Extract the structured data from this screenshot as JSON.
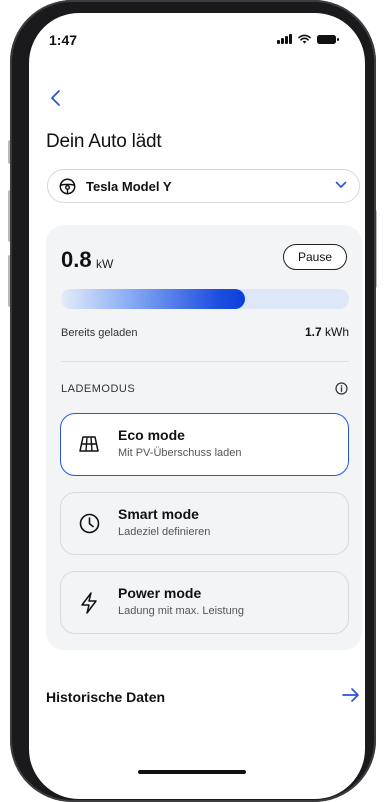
{
  "status": {
    "time": "1:47"
  },
  "header": {
    "title": "Dein Auto lädt"
  },
  "vehicle": {
    "name": "Tesla Model Y"
  },
  "charging": {
    "power_value": "0.8",
    "power_unit": "kW",
    "pause_label": "Pause",
    "progress_fraction": 0.64,
    "loaded_label": "Bereits geladen",
    "loaded_value": "1.7",
    "loaded_unit": "kWh"
  },
  "modes": {
    "section_label": "LADEMODUS",
    "items": [
      {
        "title": "Eco mode",
        "subtitle": "Mit PV-Überschuss laden",
        "icon": "solar-panel-icon",
        "active": true
      },
      {
        "title": "Smart mode",
        "subtitle": "Ladeziel definieren",
        "icon": "clock-icon",
        "active": false
      },
      {
        "title": "Power mode",
        "subtitle": "Ladung mit max. Leistung",
        "icon": "lightning-icon",
        "active": false
      }
    ]
  },
  "history": {
    "label": "Historische Daten"
  },
  "colors": {
    "accent": "#2B54D6",
    "card_bg": "#F3F4F6"
  }
}
